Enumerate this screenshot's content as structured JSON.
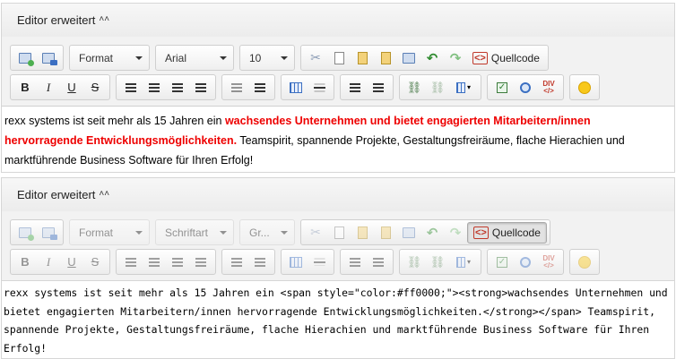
{
  "editors": [
    {
      "header": {
        "title": "Editor erweitert",
        "chevron": "˄˄"
      },
      "toolbar": {
        "format_label": "Format",
        "font_label": "Arial",
        "size_label": "10",
        "source_label": "Quellcode",
        "bold": "B",
        "italic": "I",
        "underline": "U",
        "strike": "S"
      },
      "content": {
        "text_before": "rexx systems ist seit mehr als 15 Jahren ein ",
        "highlight": "wachsendes Unternehmen und bietet engagierten Mitarbeitern/innen hervorragende Entwicklungsmöglichkeiten.",
        "text_after": " Teamspirit, spannende Projekte, Gestaltungsfreiräume, flache Hierachien und marktführende Business Software für Ihren Erfolg!",
        "highlight_color": "#ee0000"
      }
    },
    {
      "header": {
        "title": "Editor erweitert",
        "chevron": "˄˄"
      },
      "toolbar": {
        "format_label": "Format",
        "font_label": "Schriftart",
        "size_label": "Gr...",
        "source_label": "Quellcode",
        "bold": "B",
        "italic": "I",
        "underline": "U",
        "strike": "S"
      },
      "content": {
        "source_code": "rexx systems ist seit mehr als 15 Jahren ein <span style=\"color:#ff0000;\"><strong>wachsendes Unternehmen und bietet engagierten Mitarbeitern/innen hervorragende Entwicklungsmöglichkeiten.</strong></span> Teamspirit, spannende Projekte, Gestaltungsfreiräume, flache Hierachien und marktführende Business Software für Ihren Erfolg!"
      }
    }
  ],
  "icons": [
    "image-icon",
    "flash-icon",
    "cut-icon",
    "copy-icon",
    "paste-icon",
    "paste-text-icon",
    "paste-word-icon",
    "undo-icon",
    "redo-icon",
    "source-icon",
    "bold-icon",
    "italic-icon",
    "underline-icon",
    "strike-icon",
    "align-left-icon",
    "align-center-icon",
    "align-right-icon",
    "align-justify-icon",
    "outdent-icon",
    "indent-icon",
    "table-icon",
    "horizontal-rule-icon",
    "numbered-list-icon",
    "bulleted-list-icon",
    "link-icon",
    "unlink-icon",
    "color-icon",
    "checkbox-icon",
    "radio-icon",
    "div-icon",
    "smiley-icon"
  ]
}
